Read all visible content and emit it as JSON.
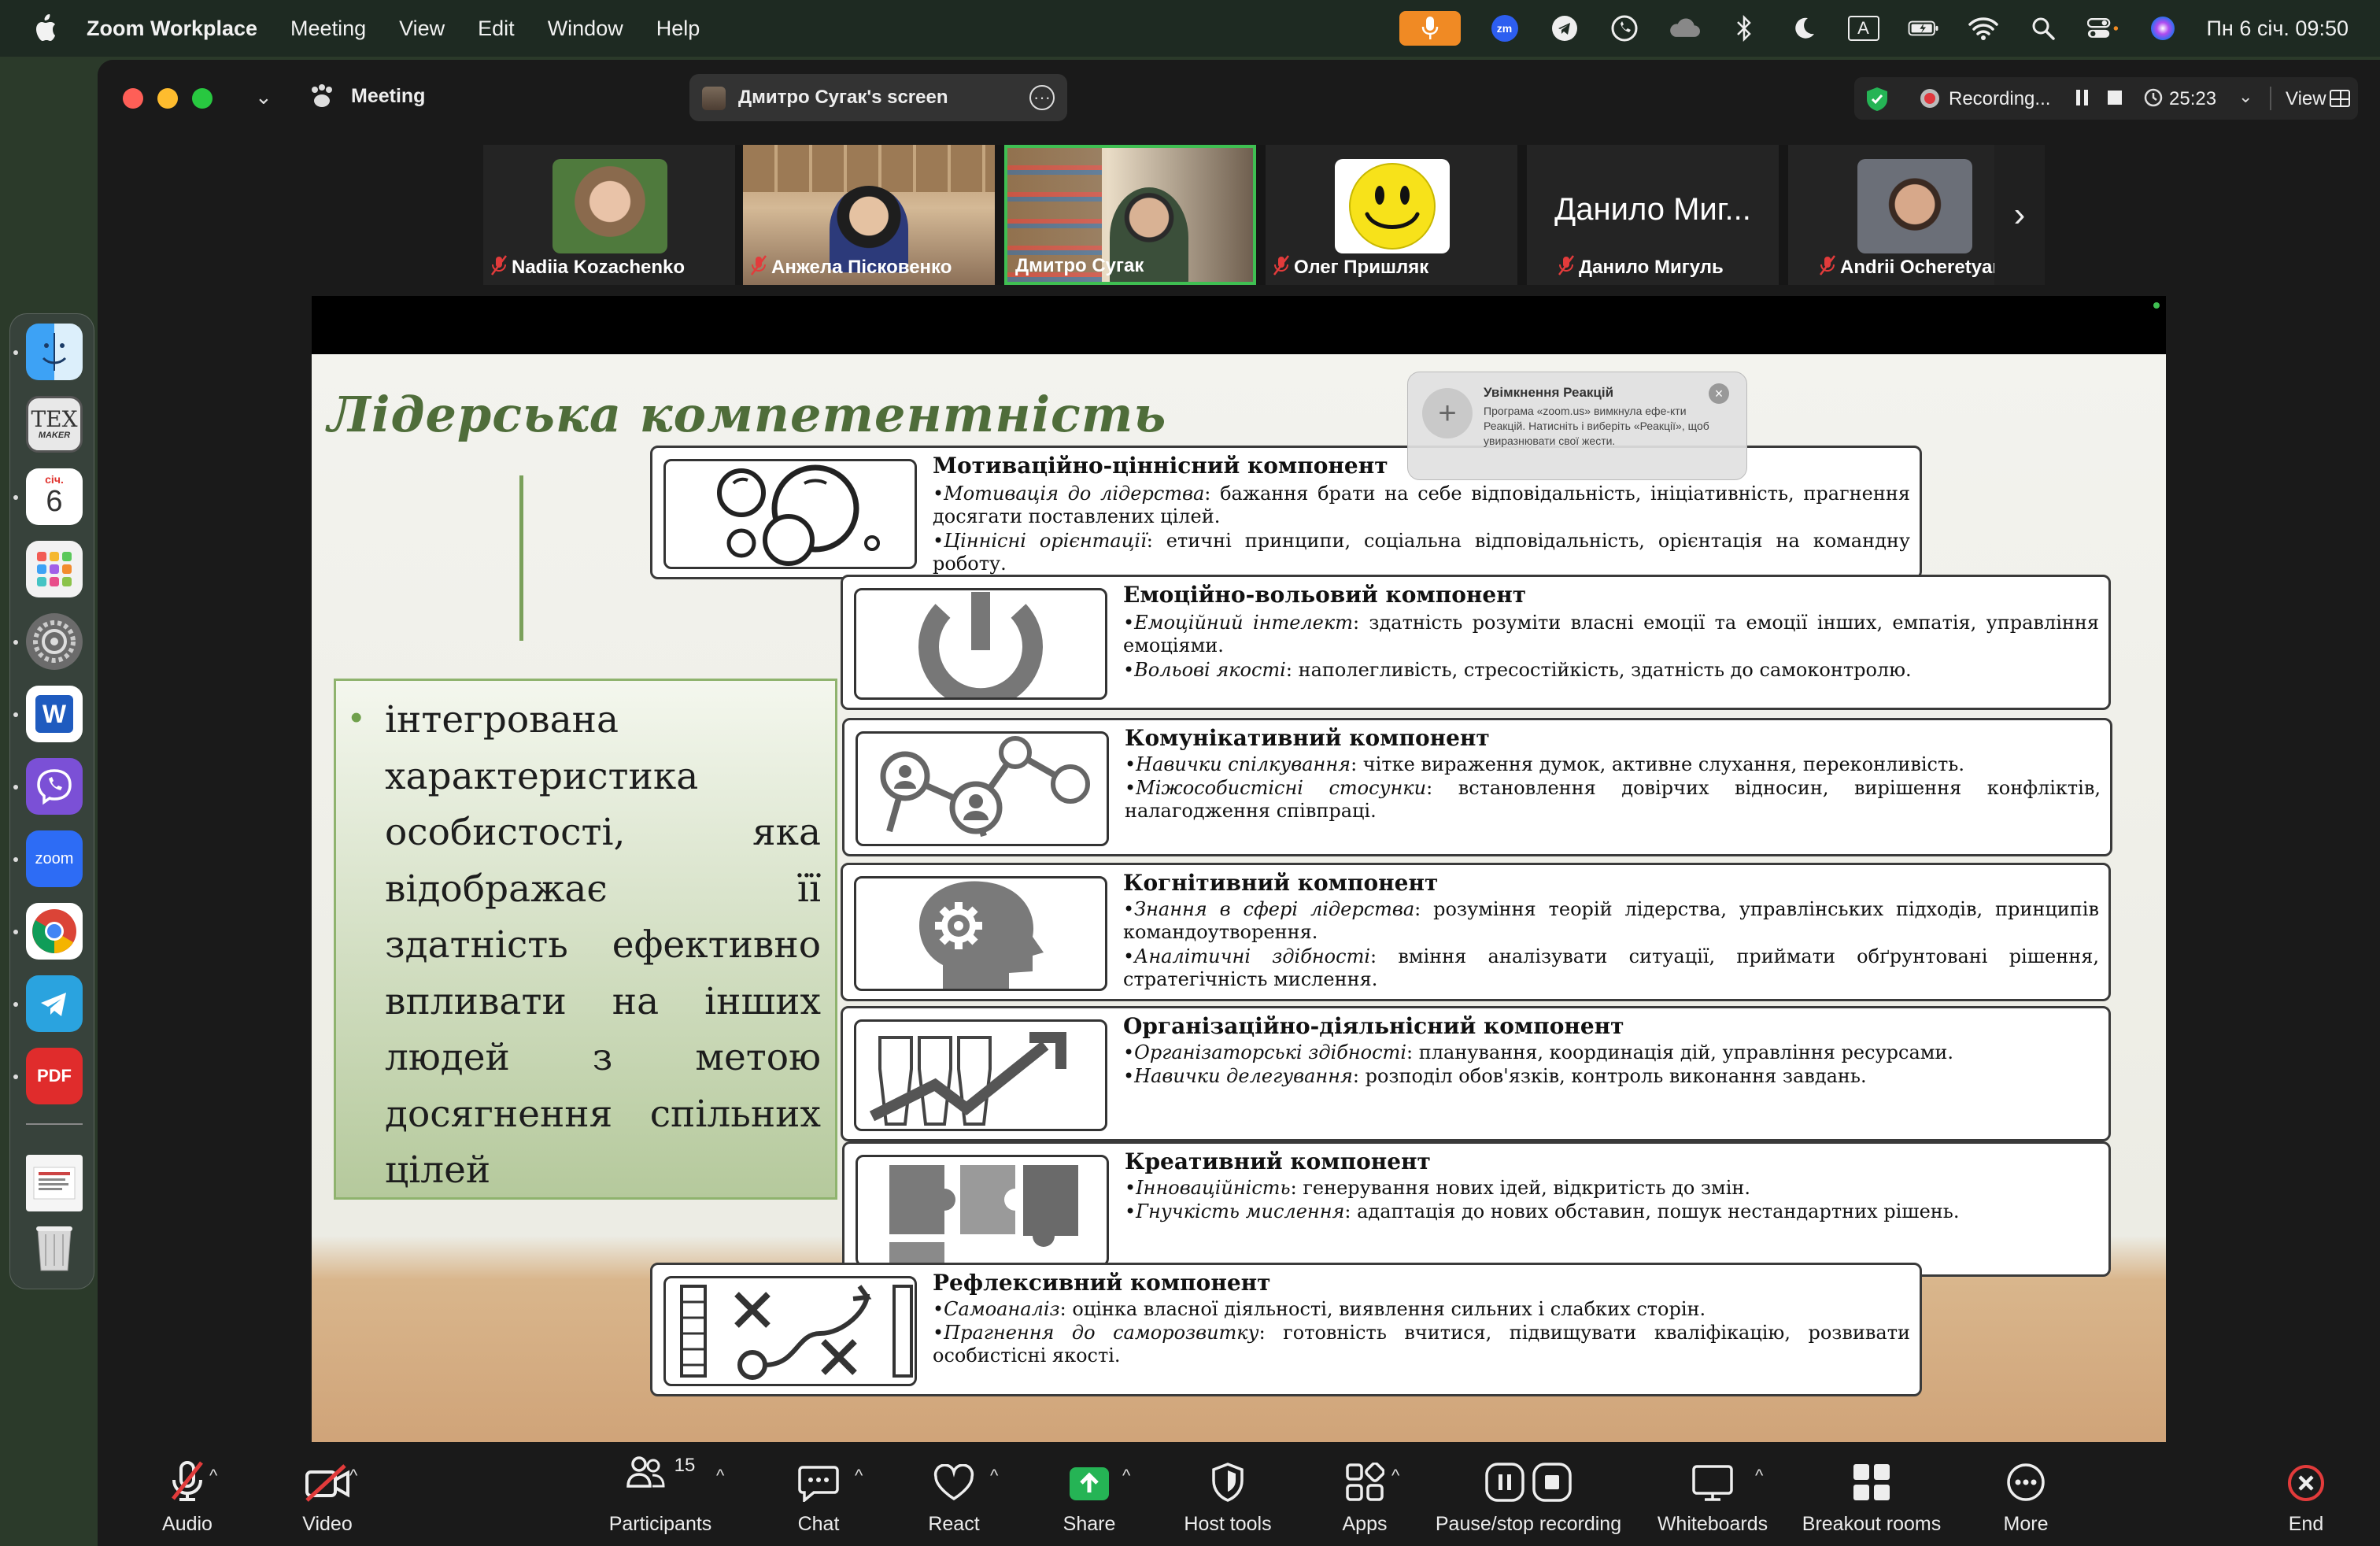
{
  "menubar": {
    "app_name": "Zoom Workplace",
    "items": [
      "Meeting",
      "View",
      "Edit",
      "Window",
      "Help"
    ],
    "datetime": "Пн 6 січ.  09:50",
    "zoom_badge": "zm",
    "input_source": "A"
  },
  "dock": {
    "calendar_month": "січ.",
    "calendar_day": "6",
    "texmaker_label": "TEX",
    "texmaker_sub": "MAKER",
    "word_letter": "W",
    "zoom_label": "zoom",
    "pdf_label": "PDF"
  },
  "window": {
    "title": "Meeting",
    "share_label": "Дмитро Сугак's screen",
    "recording_label": "Recording...",
    "timer": "25:23",
    "view_label": "View"
  },
  "participants": [
    {
      "name": "Nadiia Kozachenko",
      "muted": true
    },
    {
      "name": "Анжела Пісковенко",
      "muted": true
    },
    {
      "name": "Дмитро Сугак",
      "muted": false,
      "active": true
    },
    {
      "name": "Олег Пришляк",
      "muted": true
    },
    {
      "name": "Данило Мигуль",
      "muted": true,
      "display_text": "Данило Миг..."
    },
    {
      "name": "Andrii Ocheretyanyi",
      "muted": true
    }
  ],
  "notification": {
    "title": "Увімкнення Реакцій",
    "body": "Програма «zoom.us» вимкнула ефе-кти Реакцій. Натисніть  і виберіть «Реакції», щоб увиразнювати свої жести."
  },
  "slide": {
    "title": "Лідерська компетентність",
    "definition": "інтегрована характеристика особистості, яка відображає її здатність ефективно впливати на інших людей з метою досягнення спільних цілей",
    "components": [
      {
        "title": "Мотиваційно-ціннісний компонент",
        "lines": [
          {
            "term": "Мотивація до лідерства",
            "text": ": бажання брати на себе відповідальність, ініціативність, прагнення досягати поставлених цілей."
          },
          {
            "term": "Ціннісні орієнтації",
            "text": ": етичні принципи, соціальна відповідальність, орієнтація на командну роботу."
          }
        ]
      },
      {
        "title": "Емоційно-вольовий компонент",
        "lines": [
          {
            "term": "Емоційний інтелект",
            "text": ": здатність розуміти власні емоції та емоції інших, емпатія, управління емоціями."
          },
          {
            "term": "Вольові якості",
            "text": ": наполегливість, стресостійкість, здатність до самоконтролю."
          }
        ]
      },
      {
        "title": "Комунікативний компонент",
        "lines": [
          {
            "term": "Навички спілкування",
            "text": ": чітке вираження думок, активне слухання, переконливість."
          },
          {
            "term": "Міжособистісні стосунки",
            "text": ": встановлення довірчих відносин, вирішення конфліктів, налагодження співпраці."
          }
        ]
      },
      {
        "title": "Когнітивний компонент",
        "lines": [
          {
            "term": "Знання в сфері лідерства",
            "text": ": розуміння теорій лідерства, управлінських підходів, принципів командоутворення."
          },
          {
            "term": "Аналітичні здібності",
            "text": ": вміння аналізувати ситуації, приймати обґрунтовані рішення, стратегічність мислення."
          }
        ]
      },
      {
        "title": "Організаційно-діяльнісний компонент",
        "lines": [
          {
            "term": "Організаторські здібності",
            "text": ": планування, координація дій, управління ресурсами."
          },
          {
            "term": "Навички делегування",
            "text": ": розподіл обов'язків, контроль виконання завдань."
          }
        ]
      },
      {
        "title": "Креативний компонент",
        "lines": [
          {
            "term": "Інноваційність",
            "text": ": генерування нових ідей, відкритість до змін."
          },
          {
            "term": "Гнучкість мислення",
            "text": ": адаптація до нових обставин, пошук нестандартних рішень."
          }
        ]
      },
      {
        "title": "Рефлексивний компонент",
        "lines": [
          {
            "term": "Самоаналіз",
            "text": ": оцінка власної діяльності, виявлення сильних і слабких сторін."
          },
          {
            "term": "Прагнення до саморозвитку",
            "text": ": готовність вчитися, підвищувати кваліфікацію, розвивати особистісні якості."
          }
        ]
      }
    ]
  },
  "toolbar": {
    "audio": "Audio",
    "video": "Video",
    "participants": "Participants",
    "participants_count": "15",
    "chat": "Chat",
    "react": "React",
    "share": "Share",
    "host_tools": "Host tools",
    "apps": "Apps",
    "pause_recording": "Pause/stop recording",
    "whiteboards": "Whiteboards",
    "breakout_rooms": "Breakout rooms",
    "more": "More",
    "end": "End"
  }
}
